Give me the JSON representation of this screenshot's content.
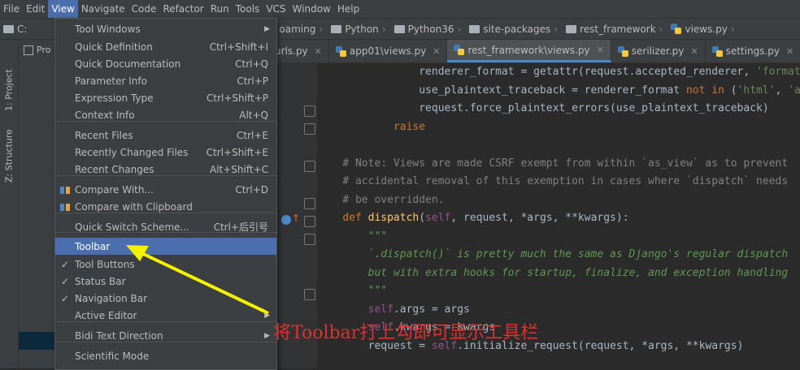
{
  "menubar": {
    "items": [
      "File",
      "Edit",
      "View",
      "Navigate",
      "Code",
      "Refactor",
      "Run",
      "Tools",
      "VCS",
      "Window",
      "Help"
    ],
    "active_index": 2
  },
  "navbar": {
    "crumbs": [
      {
        "label": "C:",
        "icon": "folder-icon"
      },
      {
        "label": "oaming",
        "icon": "none"
      },
      {
        "label": "Python",
        "icon": "folder-icon"
      },
      {
        "label": "Python36",
        "icon": "folder-icon"
      },
      {
        "label": "site-packages",
        "icon": "folder-icon"
      },
      {
        "label": "rest_framework",
        "icon": "folder-icon"
      },
      {
        "label": "views.py",
        "icon": "python-file-icon"
      }
    ]
  },
  "leftbar": {
    "project_tab": "1: Project",
    "structure_tab": "Z: Structure"
  },
  "project_panel": {
    "tab_label": "Pro"
  },
  "tabs": [
    {
      "label": "urls.py",
      "active": false
    },
    {
      "label": "app01\\views.py",
      "active": false
    },
    {
      "label": "rest_framework\\views.py",
      "active": true
    },
    {
      "label": "serilizer.py",
      "active": false
    },
    {
      "label": "settings.py",
      "active": false
    }
  ],
  "view_menu": {
    "items": [
      {
        "label": "Tool Windows",
        "shortcut": "",
        "submenu": true,
        "check": false
      },
      {
        "label": "Quick Definition",
        "shortcut": "Ctrl+Shift+I"
      },
      {
        "label": "Quick Documentation",
        "shortcut": "Ctrl+Q"
      },
      {
        "label": "Parameter Info",
        "shortcut": "Ctrl+P"
      },
      {
        "label": "Expression Type",
        "shortcut": "Ctrl+Shift+P"
      },
      {
        "label": "Context Info",
        "shortcut": "Alt+Q"
      },
      {
        "label": "Recent Files",
        "shortcut": "Ctrl+E"
      },
      {
        "label": "Recently Changed Files",
        "shortcut": "Ctrl+Shift+E"
      },
      {
        "label": "Recent Changes",
        "shortcut": "Alt+Shift+C"
      },
      {
        "label": "Compare With...",
        "shortcut": "Ctrl+D",
        "icon": "compare-icon"
      },
      {
        "label": "Compare with Clipboard",
        "shortcut": "",
        "icon": "clipboard-compare-icon"
      },
      {
        "label": "Quick Switch Scheme...",
        "shortcut": "Ctrl+后引号"
      },
      {
        "label": "Toolbar",
        "shortcut": "",
        "highlighted": true
      },
      {
        "label": "Tool Buttons",
        "shortcut": "",
        "check": true
      },
      {
        "label": "Status Bar",
        "shortcut": "",
        "check": true
      },
      {
        "label": "Navigation Bar",
        "shortcut": "",
        "check": true
      },
      {
        "label": "Active Editor",
        "shortcut": "",
        "submenu": true
      },
      {
        "label": "Bidi Text Direction",
        "shortcut": "",
        "submenu": true
      },
      {
        "label": "Scientific Mode",
        "shortcut": ""
      }
    ]
  },
  "annotation": {
    "text": "将Toolbar打上勾即可显示工具栏",
    "color": "#e03030"
  },
  "code_lines": [
    "                renderer_format = getattr(request.accepted_renderer, 'format')",
    "                use_plaintext_traceback = renderer_format not in ('html', 'api",
    "                request.force_plaintext_errors(use_plaintext_traceback)",
    "            raise",
    "",
    "    # Note: Views are made CSRF exempt from within `as_view` as to prevent",
    "    # accidental removal of this exemption in cases where `dispatch` needs",
    "    # be overridden.",
    "    def dispatch(self, request, *args, **kwargs):",
    "        \"\"\"",
    "        `.dispatch()` is pretty much the same as Django's regular dispatch",
    "        but with extra hooks for startup, finalize, and exception handling",
    "        \"\"\"",
    "        self.args = args",
    "        self.kwargs = kwargs",
    "        request = self.initialize_request(request, *args, **kwargs)"
  ],
  "colors": {
    "highlight": "#4b6eaf",
    "annotation_arrow": "#f5f200"
  }
}
